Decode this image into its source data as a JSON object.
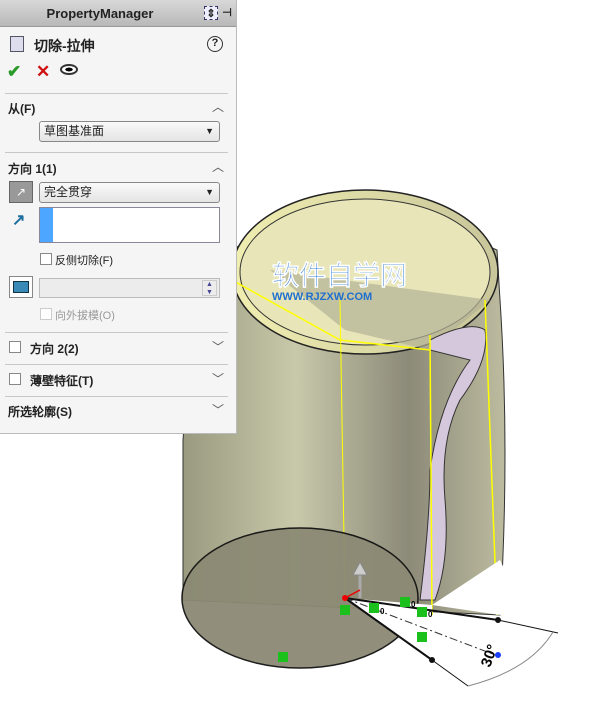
{
  "panel": {
    "title": "PropertyManager",
    "feature_name": "切除-拉伸",
    "help": "?",
    "from": {
      "header": "从(F)",
      "value": "草图基准面"
    },
    "direction1": {
      "header": "方向 1(1)",
      "end_condition": "完全贯穿",
      "flip_side_label": "反侧切除(F)",
      "draft_outward_label": "向外拔模(O)"
    },
    "direction2": {
      "header": "方向 2(2)"
    },
    "thin_feature": {
      "header": "薄壁特征(T)"
    },
    "selected_contours": {
      "header": "所选轮廓(S)"
    }
  },
  "viewport": {
    "watermark_title": "软件自学网",
    "watermark_url": "WWW.RJZXW.COM",
    "dimension": "30°",
    "relation_marks": [
      "0",
      "0",
      "0"
    ]
  },
  "colors": {
    "mug_body": "#a8a88a",
    "mug_rim": "#f2f0b0",
    "selection": "#ffff00",
    "accent": "#4da6ff"
  }
}
